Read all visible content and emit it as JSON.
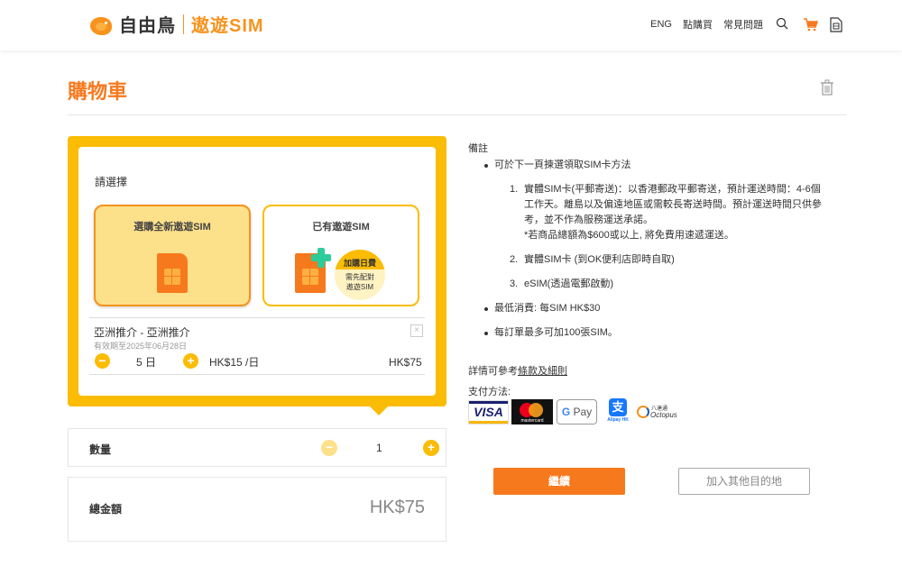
{
  "header": {
    "brand_name": "自由鳥",
    "brand_product": "遨遊SIM",
    "nav": {
      "lang": "ENG",
      "how_to_buy": "點購買",
      "faq": "常見問題"
    },
    "icons": [
      "search-icon",
      "cart-icon",
      "sim-icon"
    ]
  },
  "page": {
    "title": "購物車"
  },
  "card": {
    "choose_label": "請選擇",
    "option_new": "選購全新遨遊SIM",
    "option_have": "已有遨遊SIM",
    "addon_title": "加購日費",
    "addon_sub_1": "需先配對",
    "addon_sub_2": "遨遊SIM"
  },
  "item": {
    "name": "亞洲推介 - 亞洲推介",
    "valid_until": "有效期至2025年06月28日",
    "days": "5 日",
    "daily_price": "HK$15 /日",
    "price": "HK$75",
    "minus": "−",
    "plus": "+",
    "remove": "×"
  },
  "quantity": {
    "label": "數量",
    "value": "1",
    "minus": "−",
    "plus": "+"
  },
  "total": {
    "label": "總金額",
    "value": "HK$75"
  },
  "notes": {
    "title": "備註",
    "bullet1": "可於下一頁揀選領取SIM卡方法",
    "sub1_num": "1.",
    "sub1_line1": "實體SIM卡(平郵寄送)：以香港郵政平郵寄送，預計運送時間：4-6個",
    "sub1_line2": "工作天。離島以及偏遠地區或需較長寄送時間。預計運送時間只供參",
    "sub1_line3": "考，並不作為服務運送承諾。",
    "sub1_line4": "*若商品總額為$600或以上, 將免費用速遞運送。",
    "sub2_num": "2.",
    "sub2": "實體SIM卡 (到OK便利店即時自取)",
    "sub3_num": "3.",
    "sub3": "eSIM(透過電郵啟動)",
    "bullet2": "最低消費: 每SIM HK$30",
    "bullet3": "每訂單最多可加100張SIM。"
  },
  "terms": {
    "prefix": "詳情可參考",
    "link": "條款及細則"
  },
  "payment": {
    "label": "支付方法:",
    "visa": "VISA",
    "mastercard": "mastercard",
    "gpay_g": "G",
    "gpay_text": "Pay",
    "alipay_glyph": "支",
    "alipay_text": "Alipay HK",
    "octopus_cn": "八達通",
    "octopus_en": "Octopus"
  },
  "buttons": {
    "continue": "繼續",
    "add_destination": "加入其他目的地"
  },
  "colors": {
    "accent_orange": "#f7791e",
    "card_yellow": "#fbbc05"
  }
}
